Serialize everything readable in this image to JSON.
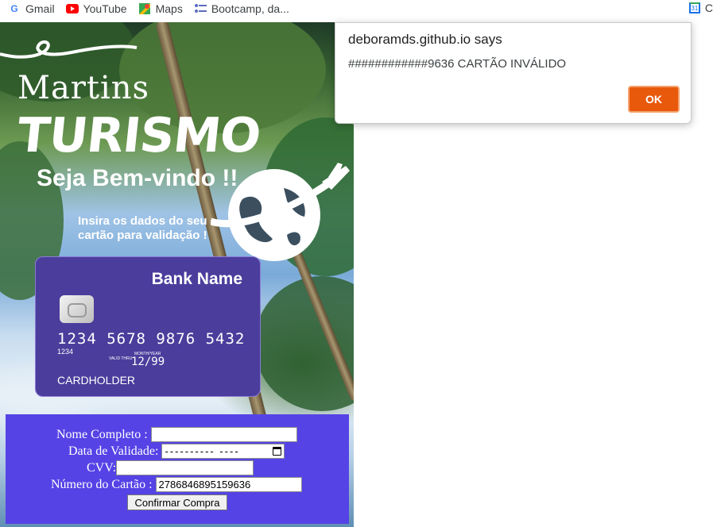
{
  "bookmarks": {
    "items": [
      {
        "label": "Gmail",
        "icon": "google-icon",
        "color": "#4285f4"
      },
      {
        "label": "YouTube",
        "icon": "youtube-icon",
        "color": "#ff0000"
      },
      {
        "label": "Maps",
        "icon": "maps-icon",
        "color": "#34a853"
      },
      {
        "label": "Bootcamp, da...",
        "icon": "bootcamp-icon",
        "color": "#5c6bc0"
      }
    ],
    "calendar_label": "31",
    "overflow_label": "C"
  },
  "hero": {
    "brand_line1": "Martins",
    "brand_line2": "TURISMO",
    "welcome": "Seja Bem-vindo !!",
    "instruction": "Insira os dados do seu cartão para validação !"
  },
  "card": {
    "bank_name": "Bank Name",
    "number": "1234 5678 9876 5432",
    "number_small": "1234",
    "valid_thru_label": "VALID THRU",
    "month_year_label": "MONTH/YEAR",
    "expiry": "12/99",
    "holder": "CARDHOLDER"
  },
  "form": {
    "name_label": "Nome Completo :",
    "name_value": "",
    "date_label": "Data de Validade:",
    "date_value": "---------- ----",
    "cvv_label": "CVV:",
    "cvv_value": "",
    "card_label": "Número do Cartão :",
    "card_value": "2786846895159636",
    "submit_label": "Confirmar Compra"
  },
  "dialog": {
    "title": "deboramds.github.io says",
    "message": "############9636 CARTÃO INVÁLIDO",
    "ok_label": "OK"
  },
  "colors": {
    "card_bg": "#4b3d9c",
    "form_bg": "#5543e6",
    "ok_button": "#e8590c"
  }
}
